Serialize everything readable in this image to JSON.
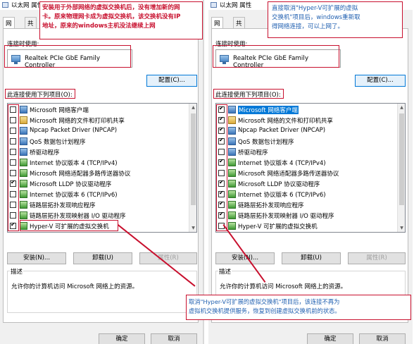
{
  "left": {
    "title": "以太网 属性",
    "close_glyph": "✕",
    "tabs": [
      "网络",
      "共享"
    ],
    "connect_using_label": "连接时使用:",
    "adapter_name": "Realtek PCIe GbE Family Controller",
    "configure_button": "配置(C)...",
    "items_label": "此连接使用下列项目(O):",
    "items": [
      {
        "text": "Microsoft 网络客户端",
        "checked": false,
        "icon": "net"
      },
      {
        "text": "Microsoft 网络的文件和打印机共享",
        "checked": false,
        "icon": "share"
      },
      {
        "text": "Npcap Packet Driver (NPCAP)",
        "checked": false,
        "icon": "net"
      },
      {
        "text": "QoS 数据包计划程序",
        "checked": false,
        "icon": "net"
      },
      {
        "text": "桥驱动程序",
        "checked": false,
        "icon": "net"
      },
      {
        "text": "Internet 协议版本 4 (TCP/IPv4)",
        "checked": false,
        "icon": "proto"
      },
      {
        "text": "Microsoft 网络适配器多路传送器协议",
        "checked": false,
        "icon": "proto"
      },
      {
        "text": "Microsoft LLDP 协议驱动程序",
        "checked": true,
        "icon": "proto"
      },
      {
        "text": "Internet 协议版本 6 (TCP/IPv6)",
        "checked": false,
        "icon": "proto"
      },
      {
        "text": "链路层拓扑发现响应程序",
        "checked": false,
        "icon": "proto"
      },
      {
        "text": "链路层拓扑发现映射器 I/O 驱动程序",
        "checked": false,
        "icon": "proto"
      },
      {
        "text": "Hyper-V 可扩展的虚拟交换机",
        "checked": true,
        "icon": "proto"
      }
    ],
    "install_button": "安装(N)...",
    "uninstall_button": "卸载(U)",
    "properties_button": "属性(R)",
    "desc_title": "描述",
    "desc_text": "允许你的计算机访问 Microsoft 网络上的资源。",
    "ok_button": "确定",
    "cancel_button": "取消",
    "callout_lines": [
      "安装用于外部网络的虚拟交换机后，没有增加新的网",
      "卡。原来物理网卡成为虚拟交换机，该交换机没有IP",
      "地址，原来的windows主机没法继续上网"
    ]
  },
  "right": {
    "title": "以太网 属性",
    "tabs": [
      "网络",
      "共享"
    ],
    "connect_using_label": "连接时使用:",
    "adapter_name": "Realtek PCIe GbE Family Controller",
    "configure_button": "配置(C)...",
    "items_label": "此连接使用下列项目(O):",
    "items": [
      {
        "text": "Microsoft 网络客户端",
        "checked": true,
        "icon": "net",
        "selected": true
      },
      {
        "text": "Microsoft 网络的文件和打印机共享",
        "checked": true,
        "icon": "share"
      },
      {
        "text": "Npcap Packet Driver (NPCAP)",
        "checked": true,
        "icon": "net"
      },
      {
        "text": "QoS 数据包计划程序",
        "checked": true,
        "icon": "net"
      },
      {
        "text": "桥驱动程序",
        "checked": false,
        "icon": "net"
      },
      {
        "text": "Internet 协议版本 4 (TCP/IPv4)",
        "checked": true,
        "icon": "proto"
      },
      {
        "text": "Microsoft 网络适配器多路传送器协议",
        "checked": false,
        "icon": "proto"
      },
      {
        "text": "Microsoft LLDP 协议驱动程序",
        "checked": true,
        "icon": "proto"
      },
      {
        "text": "Internet 协议版本 6 (TCP/IPv6)",
        "checked": true,
        "icon": "proto"
      },
      {
        "text": "链路层拓扑发现响应程序",
        "checked": true,
        "icon": "proto"
      },
      {
        "text": "链路层拓扑发现映射器 I/O 驱动程序",
        "checked": true,
        "icon": "proto"
      },
      {
        "text": "Hyper-V 可扩展的虚拟交换机",
        "checked": false,
        "icon": "proto"
      }
    ],
    "install_button": "安装(N)...",
    "uninstall_button": "卸载(U)",
    "properties_button": "属性(R)",
    "desc_title": "描述",
    "desc_text": "允许你的计算机访问 Microsoft 网络上的资源。",
    "ok_button": "确定",
    "cancel_button": "取消",
    "callout_lines": [
      "直接取消\"Hyper-V可扩展的虚拟",
      "交换机\"项目后，windows重新取",
      "得网络连接，可以上网了。"
    ]
  },
  "bottom_callout_lines": [
    "取消\"Hyper-V可扩展的虚拟交换机\"项目后，该连接不再为",
    "虚拟机交换机提供服务，恢复到创建虚拟交换机前的状态。"
  ],
  "colors": {
    "annotation_red": "#c8102e",
    "callout_blue_text": "#1f5fb0",
    "selection_blue": "#0078d7"
  }
}
